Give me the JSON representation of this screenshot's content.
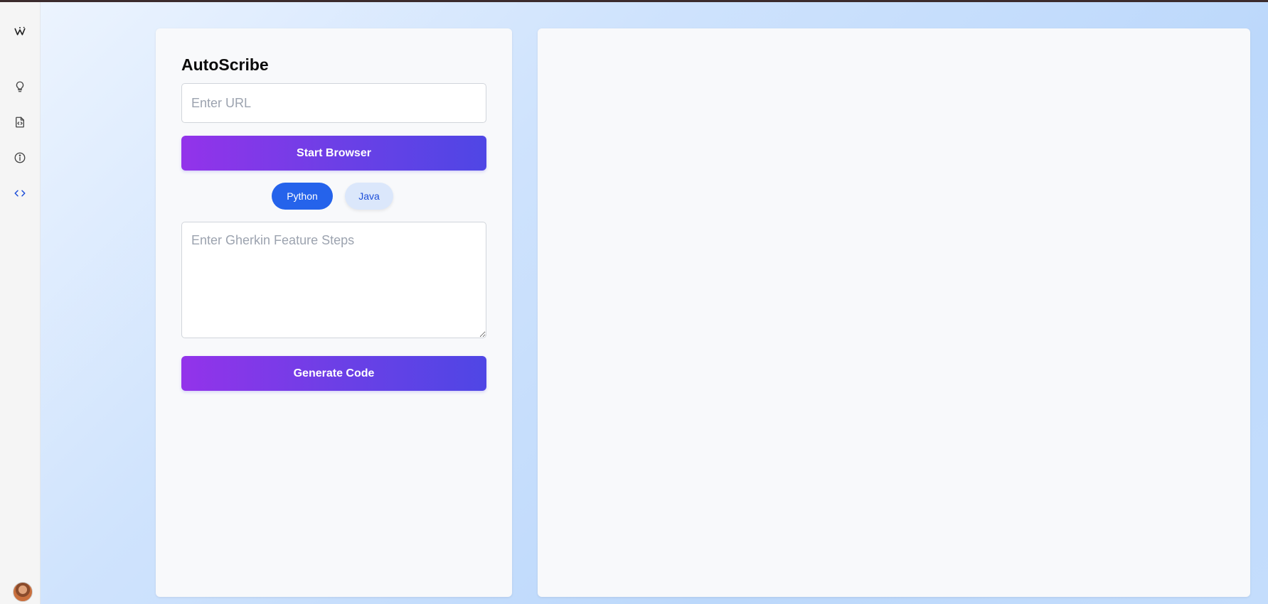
{
  "app": {
    "title": "AutoScribe"
  },
  "sidebar": {
    "items": [
      {
        "icon": "logo-icon",
        "label": ""
      },
      {
        "icon": "lightbulb-icon",
        "label": ""
      },
      {
        "icon": "file-code-icon",
        "label": ""
      },
      {
        "icon": "info-icon",
        "label": ""
      },
      {
        "icon": "code-brackets-icon",
        "label": "",
        "active": true
      }
    ],
    "active_color": "#1d4ed8"
  },
  "form": {
    "url_placeholder": "Enter URL",
    "url_value": "",
    "start_button": "Start Browser",
    "languages": [
      "Python",
      "Java"
    ],
    "selected_language": "Python",
    "gherkin_placeholder": "Enter Gherkin Feature Steps",
    "gherkin_value": "",
    "generate_button": "Generate Code"
  },
  "colors": {
    "gradient_start": "#9333ea",
    "gradient_end": "#4f46e5",
    "selected_pill": "#2563eb",
    "unselected_pill": "#dbe7fb"
  },
  "output": {
    "content": ""
  }
}
